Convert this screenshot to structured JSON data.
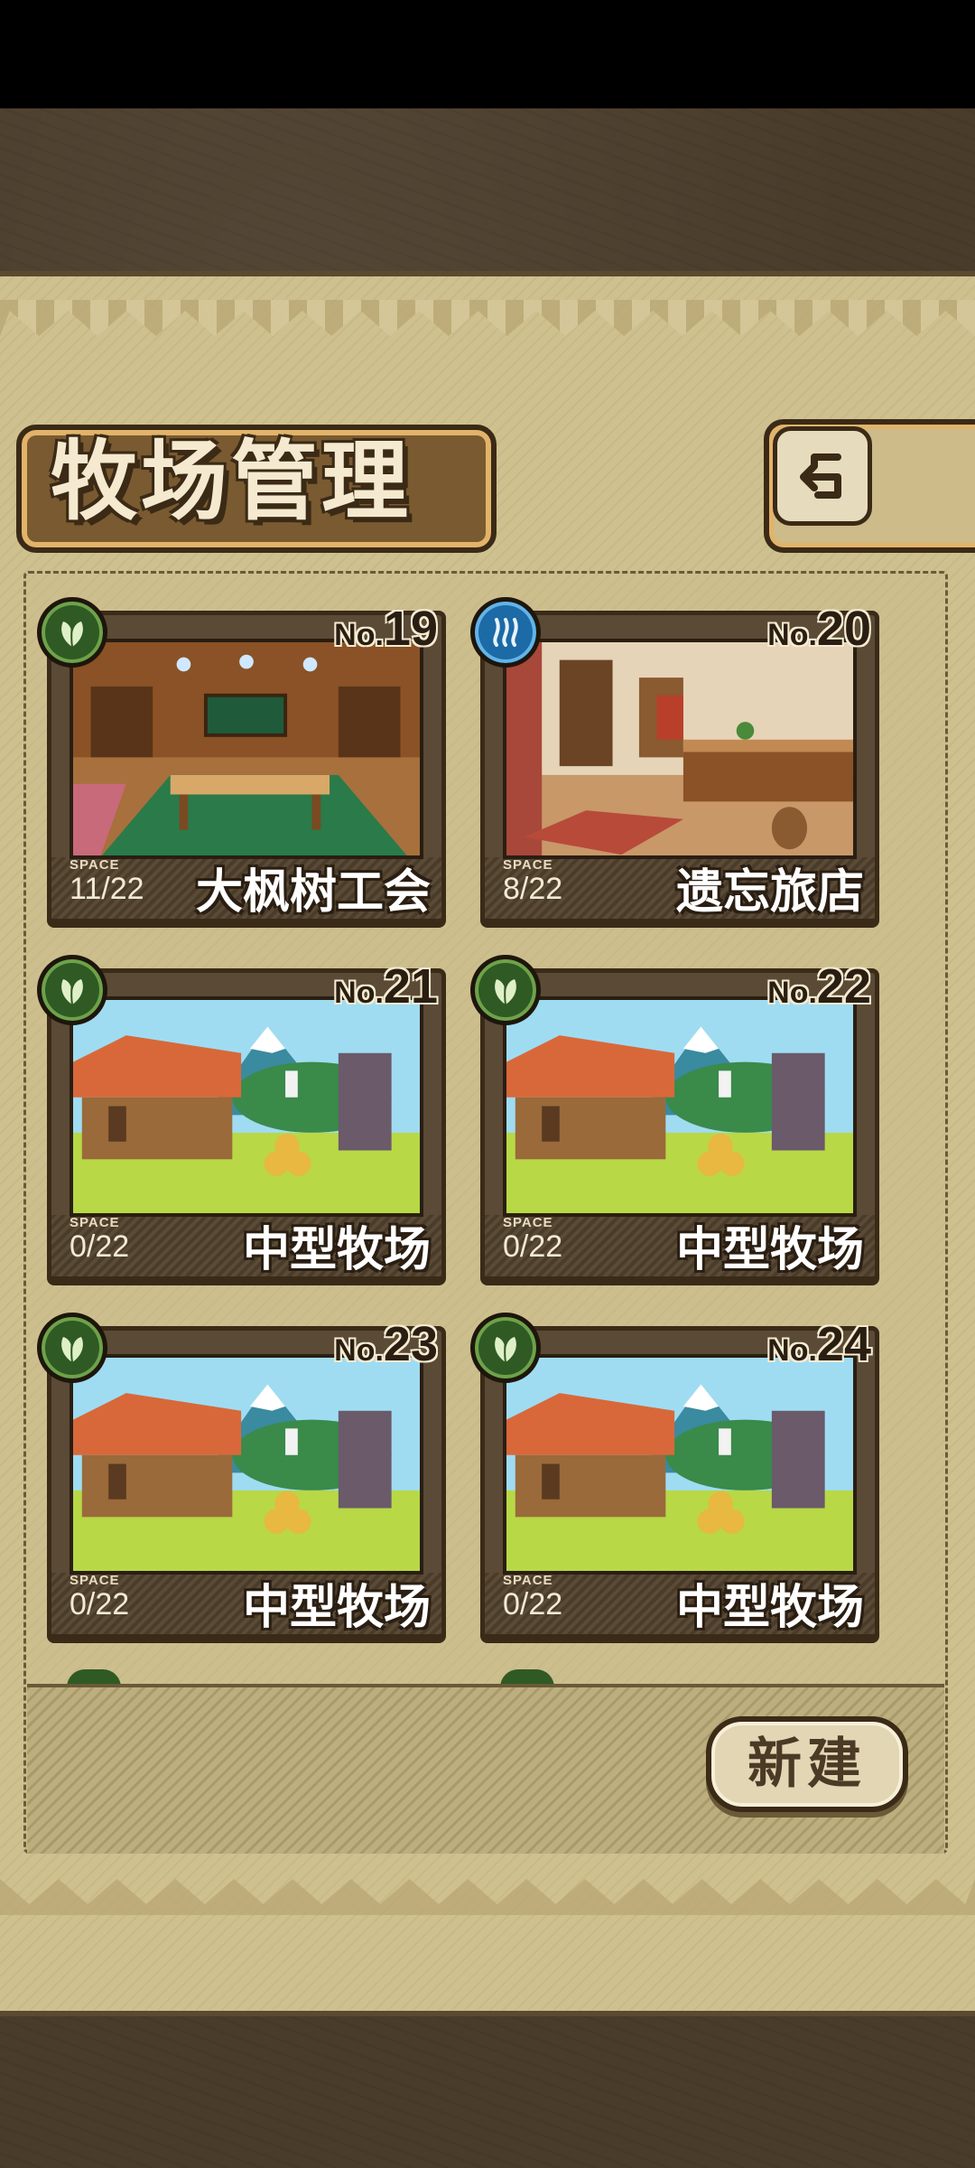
{
  "title": "牧场管理",
  "back_icon": "return-arrow-icon",
  "new_button_label": "新建",
  "space_label": "SPACE",
  "no_prefix": "No.",
  "colors": {
    "paper": "#cfc08f",
    "frame": "#3a2a18",
    "green_badge": "#2f5a24",
    "blue_badge": "#1c6aa6"
  },
  "ranches": [
    {
      "no": "19",
      "name": "大枫树工会",
      "space": "11/22",
      "badge": "leaf-icon",
      "scene": "guild-hall"
    },
    {
      "no": "20",
      "name": "遗忘旅店",
      "space": "8/22",
      "badge": "hot-spring-icon",
      "scene": "inn"
    },
    {
      "no": "21",
      "name": "中型牧场",
      "space": "0/22",
      "badge": "leaf-icon",
      "scene": "farm"
    },
    {
      "no": "22",
      "name": "中型牧场",
      "space": "0/22",
      "badge": "leaf-icon",
      "scene": "farm"
    },
    {
      "no": "23",
      "name": "中型牧场",
      "space": "0/22",
      "badge": "leaf-icon",
      "scene": "farm"
    },
    {
      "no": "24",
      "name": "中型牧场",
      "space": "0/22",
      "badge": "leaf-icon",
      "scene": "farm"
    }
  ]
}
